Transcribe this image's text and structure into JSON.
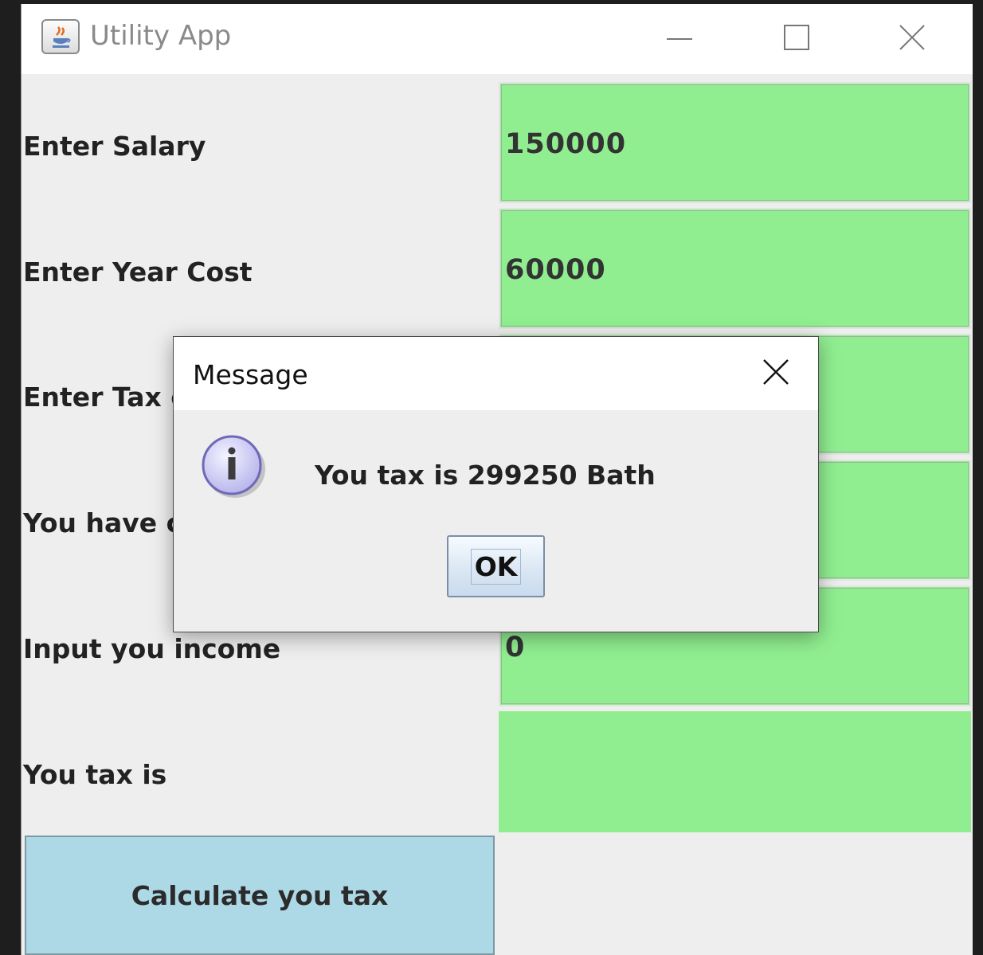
{
  "window": {
    "title": "Utility App",
    "controls": {
      "minimize": "minimize-icon",
      "maximize": "maximize-icon",
      "close": "close-icon"
    }
  },
  "form": {
    "rows": [
      {
        "label": "Enter Salary",
        "value": "150000"
      },
      {
        "label": "Enter Year Cost",
        "value": "60000"
      },
      {
        "label": "Enter Tax c",
        "value": ""
      },
      {
        "label": "You have c",
        "value": ""
      },
      {
        "label": "Input you income",
        "value": "0"
      },
      {
        "label": "You tax is",
        "value": ""
      }
    ],
    "calculate_button": "Calculate you tax"
  },
  "dialog": {
    "title": "Message",
    "message": "You tax is 299250 Bath",
    "ok_label": "OK",
    "icon": "info-icon"
  },
  "colors": {
    "field_bg": "#90ee90",
    "button_bg": "#add8e6",
    "panel_bg": "#eeeeee"
  }
}
